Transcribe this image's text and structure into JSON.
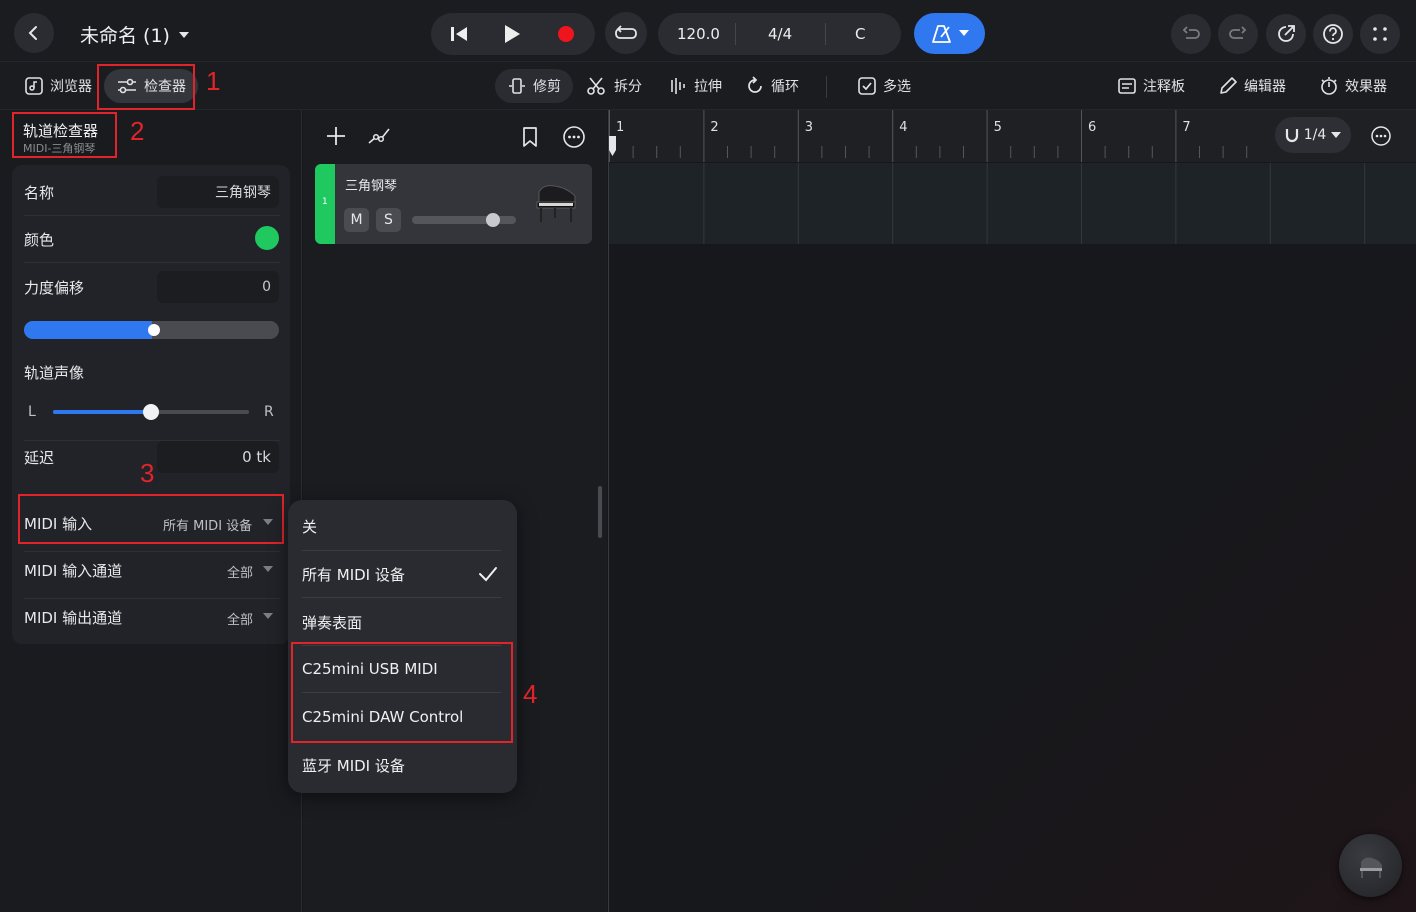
{
  "topbar": {
    "title": "未命名 (1)",
    "tempo": "120.0",
    "time_signature": "4/4",
    "key": "C"
  },
  "toolbar": {
    "browser": "浏览器",
    "inspector": "检查器",
    "trim": "修剪",
    "split": "拆分",
    "stretch": "拉伸",
    "loop": "循环",
    "multiselect": "多选",
    "notepad": "注释板",
    "editor": "编辑器",
    "effects": "效果器"
  },
  "annotations": [
    "1",
    "2",
    "3",
    "4"
  ],
  "inspector": {
    "title": "轨道检查器",
    "subtitle": "MIDI-三角钢琴",
    "name_label": "名称",
    "name_value": "三角钢琴",
    "color_label": "颜色",
    "color_value": "#1fc95f",
    "velocity_label": "力度偏移",
    "velocity_value": "0",
    "velocity_slider": 0.5,
    "pan_label": "轨道声像",
    "pan_left": "L",
    "pan_right": "R",
    "pan_value": 0.5,
    "delay_label": "延迟",
    "delay_value": "0 tk",
    "midi_in_label": "MIDI 输入",
    "midi_in_value": "所有 MIDI 设备",
    "midi_in_channel_label": "MIDI 输入通道",
    "midi_in_channel_value": "全部",
    "midi_out_channel_label": "MIDI 输出通道",
    "midi_out_channel_value": "全部"
  },
  "track": {
    "number": "1",
    "name": "三角钢琴",
    "mute": "M",
    "solo": "S",
    "volume": 0.78,
    "color": "#1fc95f"
  },
  "ruler": {
    "bars": [
      "1",
      "2",
      "3",
      "4",
      "5",
      "6",
      "7"
    ],
    "snap": "1/4"
  },
  "menu": {
    "items": [
      "关",
      "所有 MIDI 设备",
      "弹奏表面",
      "C25mini USB MIDI",
      "C25mini DAW Control",
      "蓝牙 MIDI 设备"
    ],
    "selected_index": 1
  }
}
